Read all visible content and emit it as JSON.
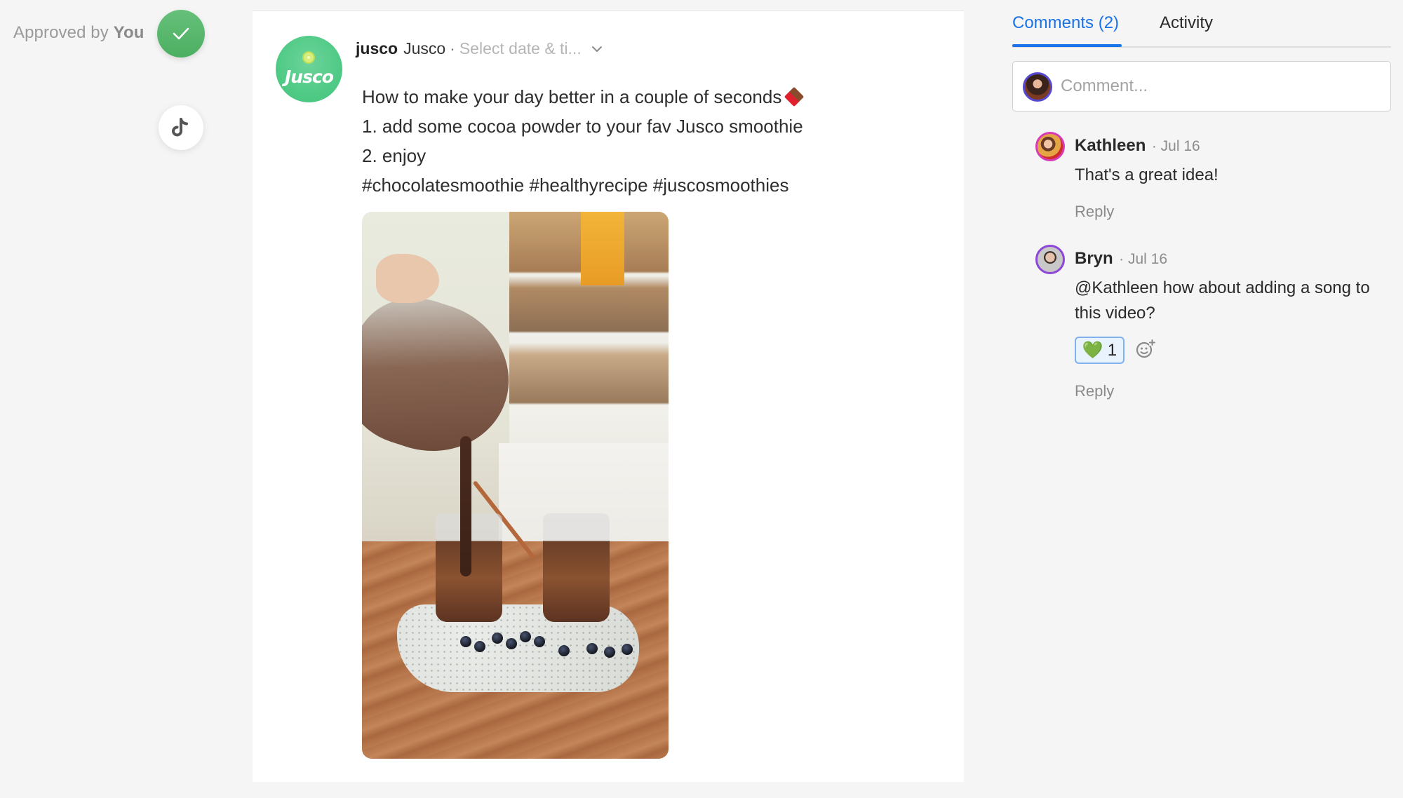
{
  "approval": {
    "prefix": "Approved by",
    "approver": "You",
    "status_color": "#4caf61"
  },
  "network": {
    "icon": "tiktok-icon"
  },
  "post": {
    "handle": "jusco",
    "account_name": "Jusco",
    "separator": "·",
    "date_placeholder": "Select date & ti...",
    "avatar_text": "Jusco",
    "caption_lines": [
      "How to make your day better in a couple of seconds",
      "1. add some cocoa powder to your fav Jusco smoothie",
      "2. enjoy",
      "#chocolatesmoothie #healthyrecipe #juscosmoothies"
    ],
    "caption_emoji": "chocolate-bar-icon",
    "media_alt": "Chocolate smoothie being poured from a blender into mason jars on a terrazzo board with blueberries"
  },
  "panel": {
    "tabs": [
      {
        "label": "Comments (2)",
        "active": true
      },
      {
        "label": "Activity",
        "active": false
      }
    ],
    "accent_color": "#1a73e8",
    "comment_input": {
      "placeholder": "Comment...",
      "value": ""
    },
    "comments": [
      {
        "author": "Kathleen",
        "time": "· Jul 16",
        "body": "That's a great idea!",
        "reply_label": "Reply"
      },
      {
        "author": "Bryn",
        "time": "· Jul 16",
        "body": "@Kathleen  how about adding a song to this video?",
        "reactions": [
          {
            "emoji": "💚",
            "count": "1"
          }
        ],
        "reply_label": "Reply"
      }
    ]
  }
}
